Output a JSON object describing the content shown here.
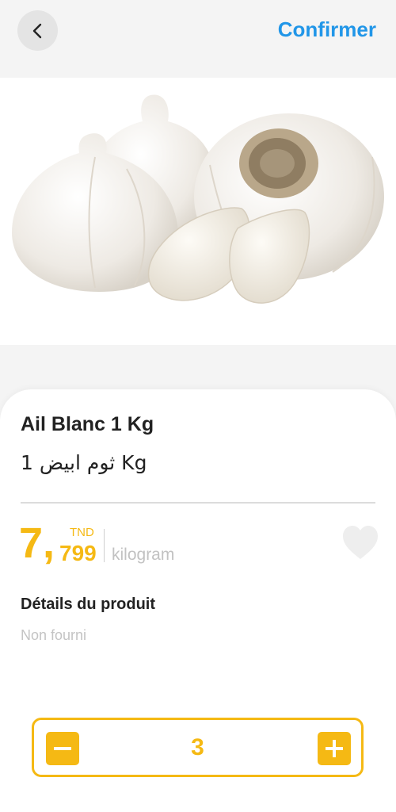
{
  "header": {
    "back_icon": "chevron-left-icon",
    "confirm_label": "Confirmer"
  },
  "product": {
    "image_alt": "garlic",
    "name": "Ail Blanc 1 Kg",
    "name_ar": "ثوم ابيض 1 Kg",
    "price_int": "7,",
    "price_dec": "799",
    "currency": "TND",
    "unit": "kilogram",
    "favorite_icon": "heart-icon",
    "details_title": "Détails du produit",
    "details_value": "Non fourni"
  },
  "quantity": {
    "value": "3",
    "minus_icon": "minus-icon",
    "plus_icon": "plus-icon"
  },
  "colors": {
    "accent": "#f5b914",
    "link": "#2196e8",
    "background": "#f4f4f4"
  }
}
